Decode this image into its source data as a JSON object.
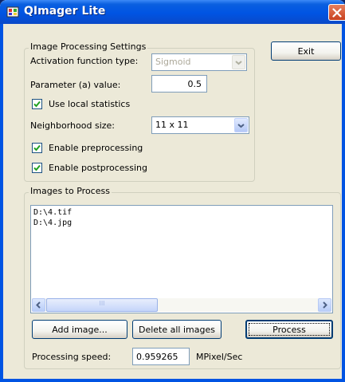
{
  "window": {
    "title": "QImager Lite"
  },
  "settings": {
    "group_label": "Image Processing Settings",
    "activation_label": "Activation function type:",
    "activation_value": "Sigmoid",
    "parameter_label": "Parameter (a) value:",
    "parameter_value": "0.5",
    "local_stats_label": "Use local statistics",
    "local_stats_checked": true,
    "neighborhood_label": "Neighborhood size:",
    "neighborhood_value": "11 x 11",
    "preprocessing_label": "Enable preprocessing",
    "preprocessing_checked": true,
    "postprocessing_label": "Enable postprocessing",
    "postprocessing_checked": true
  },
  "toolbar": {
    "exit_label": "Exit"
  },
  "images": {
    "group_label": "Images to Process",
    "items": [
      "D:\\4.tif",
      "D:\\4.jpg"
    ],
    "scroll_grip": "III",
    "add_label": "Add image...",
    "delete_label": "Delete all images",
    "process_label": "Process",
    "speed_label": "Processing speed:",
    "speed_value": "0.959265",
    "speed_unit": "MPixel/Sec"
  }
}
